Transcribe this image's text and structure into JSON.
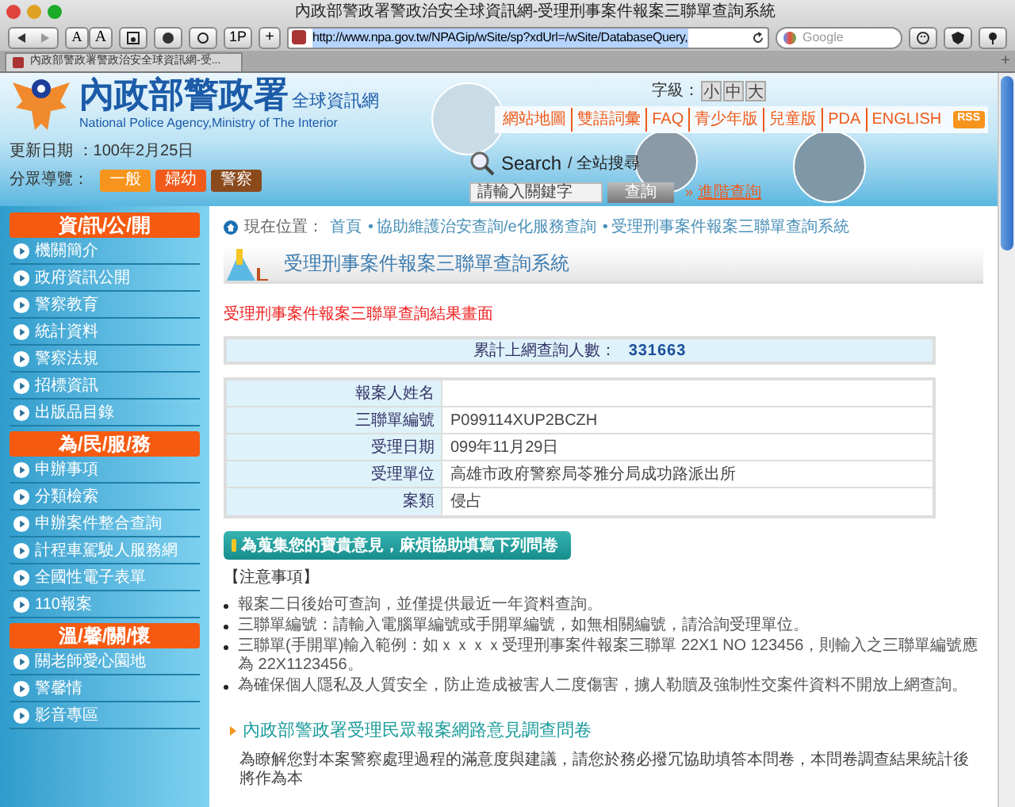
{
  "browser": {
    "title": "內政部警政署警政治安全球資訊網-受理刑事案件報案三聯單查詢系統",
    "text_size_buttons": [
      "A",
      "A"
    ],
    "one_page": "1P",
    "add": "+",
    "url": "http://www.npa.gov.tw/NPAGip/wSite/sp?xdUrl=/wSite/DatabaseQuery,",
    "search_placeholder": "Google",
    "tab": "內政部警政署警政治安全球資訊網-受..."
  },
  "header": {
    "title_zh": "內政部警政署",
    "title_suffix": "全球資訊網",
    "title_en": "National Police Agency,Ministry of The Interior",
    "updated": "更新日期 ：100年2月25日",
    "audience_label": "分眾導覽：",
    "audience": [
      {
        "label": "一般",
        "color": "#f7941d"
      },
      {
        "label": "婦幼",
        "color": "#f05a1a"
      },
      {
        "label": "警察",
        "color": "#8b4a1c"
      }
    ],
    "font_size_label": "字級：",
    "font_sizes": [
      "小",
      "中",
      "大"
    ],
    "top_links": [
      "網站地圖",
      "雙語詞彙",
      "FAQ",
      "青少年版",
      "兒童版",
      "PDA",
      "ENGLISH"
    ],
    "rss": "RSS",
    "search": {
      "title": "Search",
      "title_suffix": "/ 全站搜尋",
      "placeholder": "請輸入關鍵字",
      "button": "查詢",
      "advanced_prefix": "»",
      "advanced": "進階查詢"
    }
  },
  "sidebar": [
    {
      "title": "資/訊/公/開",
      "items": [
        "機關簡介",
        "政府資訊公開",
        "警察教育",
        "統計資料",
        "警察法規",
        "招標資訊",
        "出版品目錄"
      ]
    },
    {
      "title": "為/民/服/務",
      "items": [
        "申辦事項",
        "分類檢索",
        "申辦案件整合查詢",
        "計程車駕駛人服務網",
        "全國性電子表單",
        "110報案"
      ]
    },
    {
      "title": "溫/馨/關/懷",
      "items": [
        "關老師愛心園地",
        "警馨情",
        "影音專區"
      ]
    }
  ],
  "breadcrumb": {
    "label": "現在位置：",
    "separator": "•",
    "items": [
      "首頁",
      "協助維護治安查詢/e化服務查詢",
      "受理刑事案件報案三聯單查詢系統"
    ]
  },
  "page_title": "受理刑事案件報案三聯單查詢系統",
  "result_heading": "受理刑事案件報案三聯單查詢結果畫面",
  "counter": {
    "label": "累計上網查詢人數：",
    "value": "331663"
  },
  "details": [
    {
      "label": "報案人姓名"
    },
    {
      "label": "三聯單編號",
      "value": "P099114XUP2BCZH"
    },
    {
      "label": "受理日期",
      "value": "099年11月29日"
    },
    {
      "label": "受理單位",
      "value": "高雄市政府警察局苓雅分局成功路派出所"
    },
    {
      "label": "案類",
      "value": "侵占"
    }
  ],
  "survey_banner": "為蒐集您的寶貴意見，麻煩協助填寫下列問卷",
  "notes_title": "【注意事項】",
  "notes": [
    "報案二日後始可查詢，並僅提供最近一年資料查詢。",
    "三聯單編號：請輸入電腦單編號或手開單編號，如無相關編號，請洽詢受理單位。",
    "三聯單(手開單)輸入範例：如ｘｘｘｘ受理刑事案件報案三聯單 22X1 NO 123456，則輸入之三聯單編號應為 22X1123456。",
    "為確保個人隱私及人質安全，防止造成被害人二度傷害，擄人勒贖及強制性交案件資料不開放上網查詢。"
  ],
  "survey": {
    "title": "內政部警政署受理民眾報案網路意見調查問卷",
    "text": "為瞭解您對本案警察處理過程的滿意度與建議，請您於務必撥冗協助填答本問卷，本問卷調查結果統計後將作為本"
  }
}
